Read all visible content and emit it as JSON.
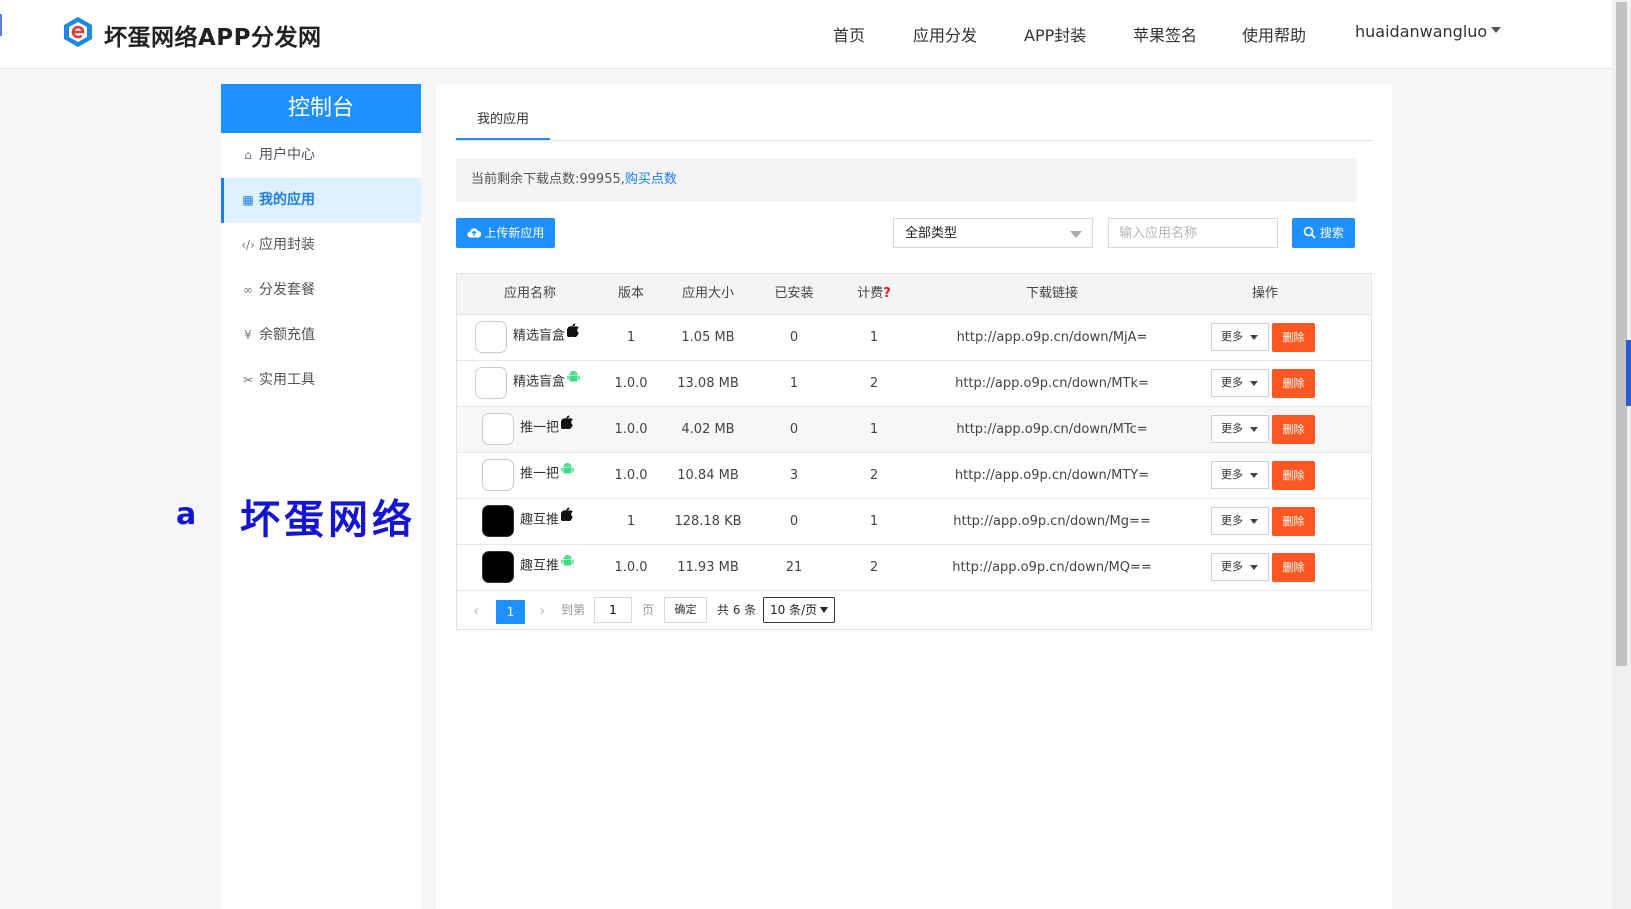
{
  "header": {
    "site_title": "坏蛋网络APP分发网",
    "nav": [
      "首页",
      "应用分发",
      "APP封装",
      "苹果签名",
      "使用帮助"
    ],
    "user": "huaidanwangluo"
  },
  "sidebar": {
    "title": "控制台",
    "items": [
      {
        "label": "用户中心",
        "icon": "home-icon"
      },
      {
        "label": "我的应用",
        "icon": "apps-icon"
      },
      {
        "label": "应用封装",
        "icon": "code-icon"
      },
      {
        "label": "分发套餐",
        "icon": "link-icon"
      },
      {
        "label": "余额充值",
        "icon": "yen-icon"
      },
      {
        "label": "实用工具",
        "icon": "tools-icon"
      }
    ]
  },
  "watermark": {
    "letter": "a",
    "text": "坏蛋网络"
  },
  "main": {
    "tab": "我的应用",
    "notice_text": "当前剩余下载点数:99955,",
    "notice_link": "购买点数",
    "upload_button": "上传新应用",
    "type_select": "全部类型",
    "search_placeholder": "输入应用名称",
    "search_button": "搜索"
  },
  "table": {
    "headers": [
      "应用名称",
      "版本",
      "应用大小",
      "已安装",
      "计费",
      "下载链接",
      "操作"
    ],
    "rows": [
      {
        "name": "精选盲盒",
        "platform": "ios",
        "version": "1",
        "size": "1.05 MB",
        "installed": "0",
        "billing": "1",
        "link": "http://app.o9p.cn/down/MjA=",
        "icon_style": "light"
      },
      {
        "name": "精选盲盒",
        "platform": "android",
        "version": "1.0.0",
        "size": "13.08 MB",
        "installed": "1",
        "billing": "2",
        "link": "http://app.o9p.cn/down/MTk=",
        "icon_style": "light"
      },
      {
        "name": "推一把",
        "platform": "ios",
        "version": "1.0.0",
        "size": "4.02 MB",
        "installed": "0",
        "billing": "1",
        "link": "http://app.o9p.cn/down/MTc=",
        "icon_style": "light"
      },
      {
        "name": "推一把",
        "platform": "android",
        "version": "1.0.0",
        "size": "10.84 MB",
        "installed": "3",
        "billing": "2",
        "link": "http://app.o9p.cn/down/MTY=",
        "icon_style": "light"
      },
      {
        "name": "趣互推",
        "platform": "ios",
        "version": "1",
        "size": "128.18 KB",
        "installed": "0",
        "billing": "1",
        "link": "http://app.o9p.cn/down/Mg==",
        "icon_style": "dark"
      },
      {
        "name": "趣互推",
        "platform": "android",
        "version": "1.0.0",
        "size": "11.93 MB",
        "installed": "21",
        "billing": "2",
        "link": "http://app.o9p.cn/down/MQ==",
        "icon_style": "dark"
      }
    ],
    "more_label": "更多",
    "delete_label": "删除"
  },
  "pagination": {
    "current": "1",
    "goto_label": "到第",
    "page_input": "1",
    "page_label": "页",
    "confirm": "确定",
    "total": "共 6 条",
    "page_size": "10 条/页"
  },
  "colors": {
    "primary": "#1e90ff",
    "danger": "#ff5722",
    "watermark": "#1515d0"
  }
}
